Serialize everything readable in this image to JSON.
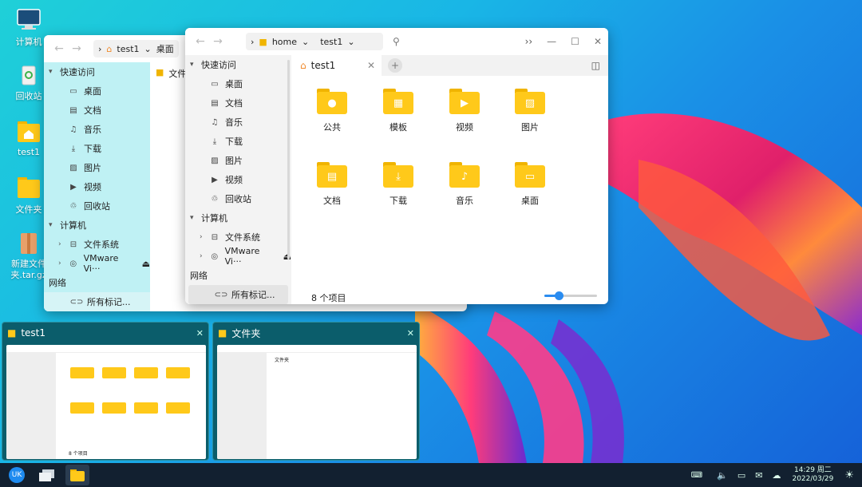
{
  "desktop": {
    "icons": [
      {
        "label": "计算机",
        "icon": "computer-icon"
      },
      {
        "label": "回收站",
        "icon": "trash-icon"
      },
      {
        "label": "test1",
        "icon": "home-folder-icon"
      },
      {
        "label": "文件夹",
        "icon": "folder-icon"
      },
      {
        "label": "新建文件夹.tar.gz",
        "icon": "archive-icon"
      }
    ]
  },
  "back_window": {
    "breadcrumb": [
      "test1",
      "桌面"
    ],
    "sidebar": {
      "quick_access": "快速访问",
      "items": [
        "桌面",
        "文档",
        "音乐",
        "下载",
        "图片",
        "视频",
        "回收站"
      ],
      "computer": "计算机",
      "computer_items": [
        "文件系统",
        "VMware Vi···"
      ],
      "network": "网络",
      "tags": "所有标记..."
    },
    "content_first": "文件"
  },
  "front_window": {
    "breadcrumb": [
      "home",
      "test1"
    ],
    "tab": "test1",
    "sidebar": {
      "quick_access": "快速访问",
      "items": [
        "桌面",
        "文档",
        "音乐",
        "下载",
        "图片",
        "视频",
        "回收站"
      ],
      "computer": "计算机",
      "computer_items": [
        "文件系统",
        "VMware Vi···"
      ],
      "network": "网络",
      "tags": "所有标记..."
    },
    "folders": [
      "公共",
      "模板",
      "视频",
      "图片",
      "文档",
      "下载",
      "音乐",
      "桌面"
    ],
    "status": "8 个项目",
    "zoom_fraction": 0.27
  },
  "thumbnails": [
    {
      "title": "test1",
      "mini_status": "8 个项目"
    },
    {
      "title": "文件夹",
      "mini_first": "文件夹"
    }
  ],
  "taskbar": {
    "time": "14:29 周二",
    "date": "2022/03/29"
  }
}
